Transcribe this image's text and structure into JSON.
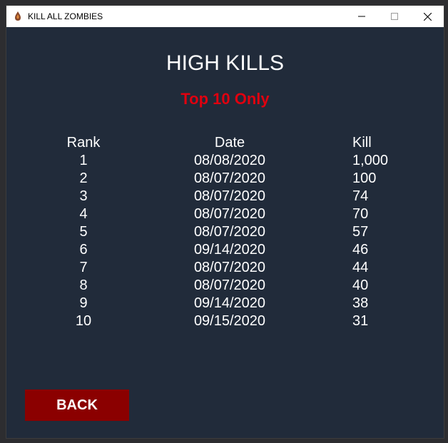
{
  "window": {
    "title": "KILL ALL ZOMBIES"
  },
  "screen": {
    "heading": "HIGH KILLS",
    "subheading": "Top 10 Only",
    "columns": {
      "rank": "Rank",
      "date": "Date",
      "kill": "Kill"
    },
    "rows": [
      {
        "rank": "1",
        "date": "08/08/2020",
        "kill": "1,000"
      },
      {
        "rank": "2",
        "date": "08/07/2020",
        "kill": "100"
      },
      {
        "rank": "3",
        "date": "08/07/2020",
        "kill": "74"
      },
      {
        "rank": "4",
        "date": "08/07/2020",
        "kill": "70"
      },
      {
        "rank": "5",
        "date": "08/07/2020",
        "kill": "57"
      },
      {
        "rank": "6",
        "date": "09/14/2020",
        "kill": "46"
      },
      {
        "rank": "7",
        "date": "08/07/2020",
        "kill": "44"
      },
      {
        "rank": "8",
        "date": "08/07/2020",
        "kill": "40"
      },
      {
        "rank": "9",
        "date": "09/14/2020",
        "kill": "38"
      },
      {
        "rank": "10",
        "date": "09/15/2020",
        "kill": "31"
      }
    ],
    "back_label": "BACK"
  },
  "colors": {
    "background": "#212b3a",
    "accent_red": "#e0000f",
    "button_red": "#8b0000"
  }
}
